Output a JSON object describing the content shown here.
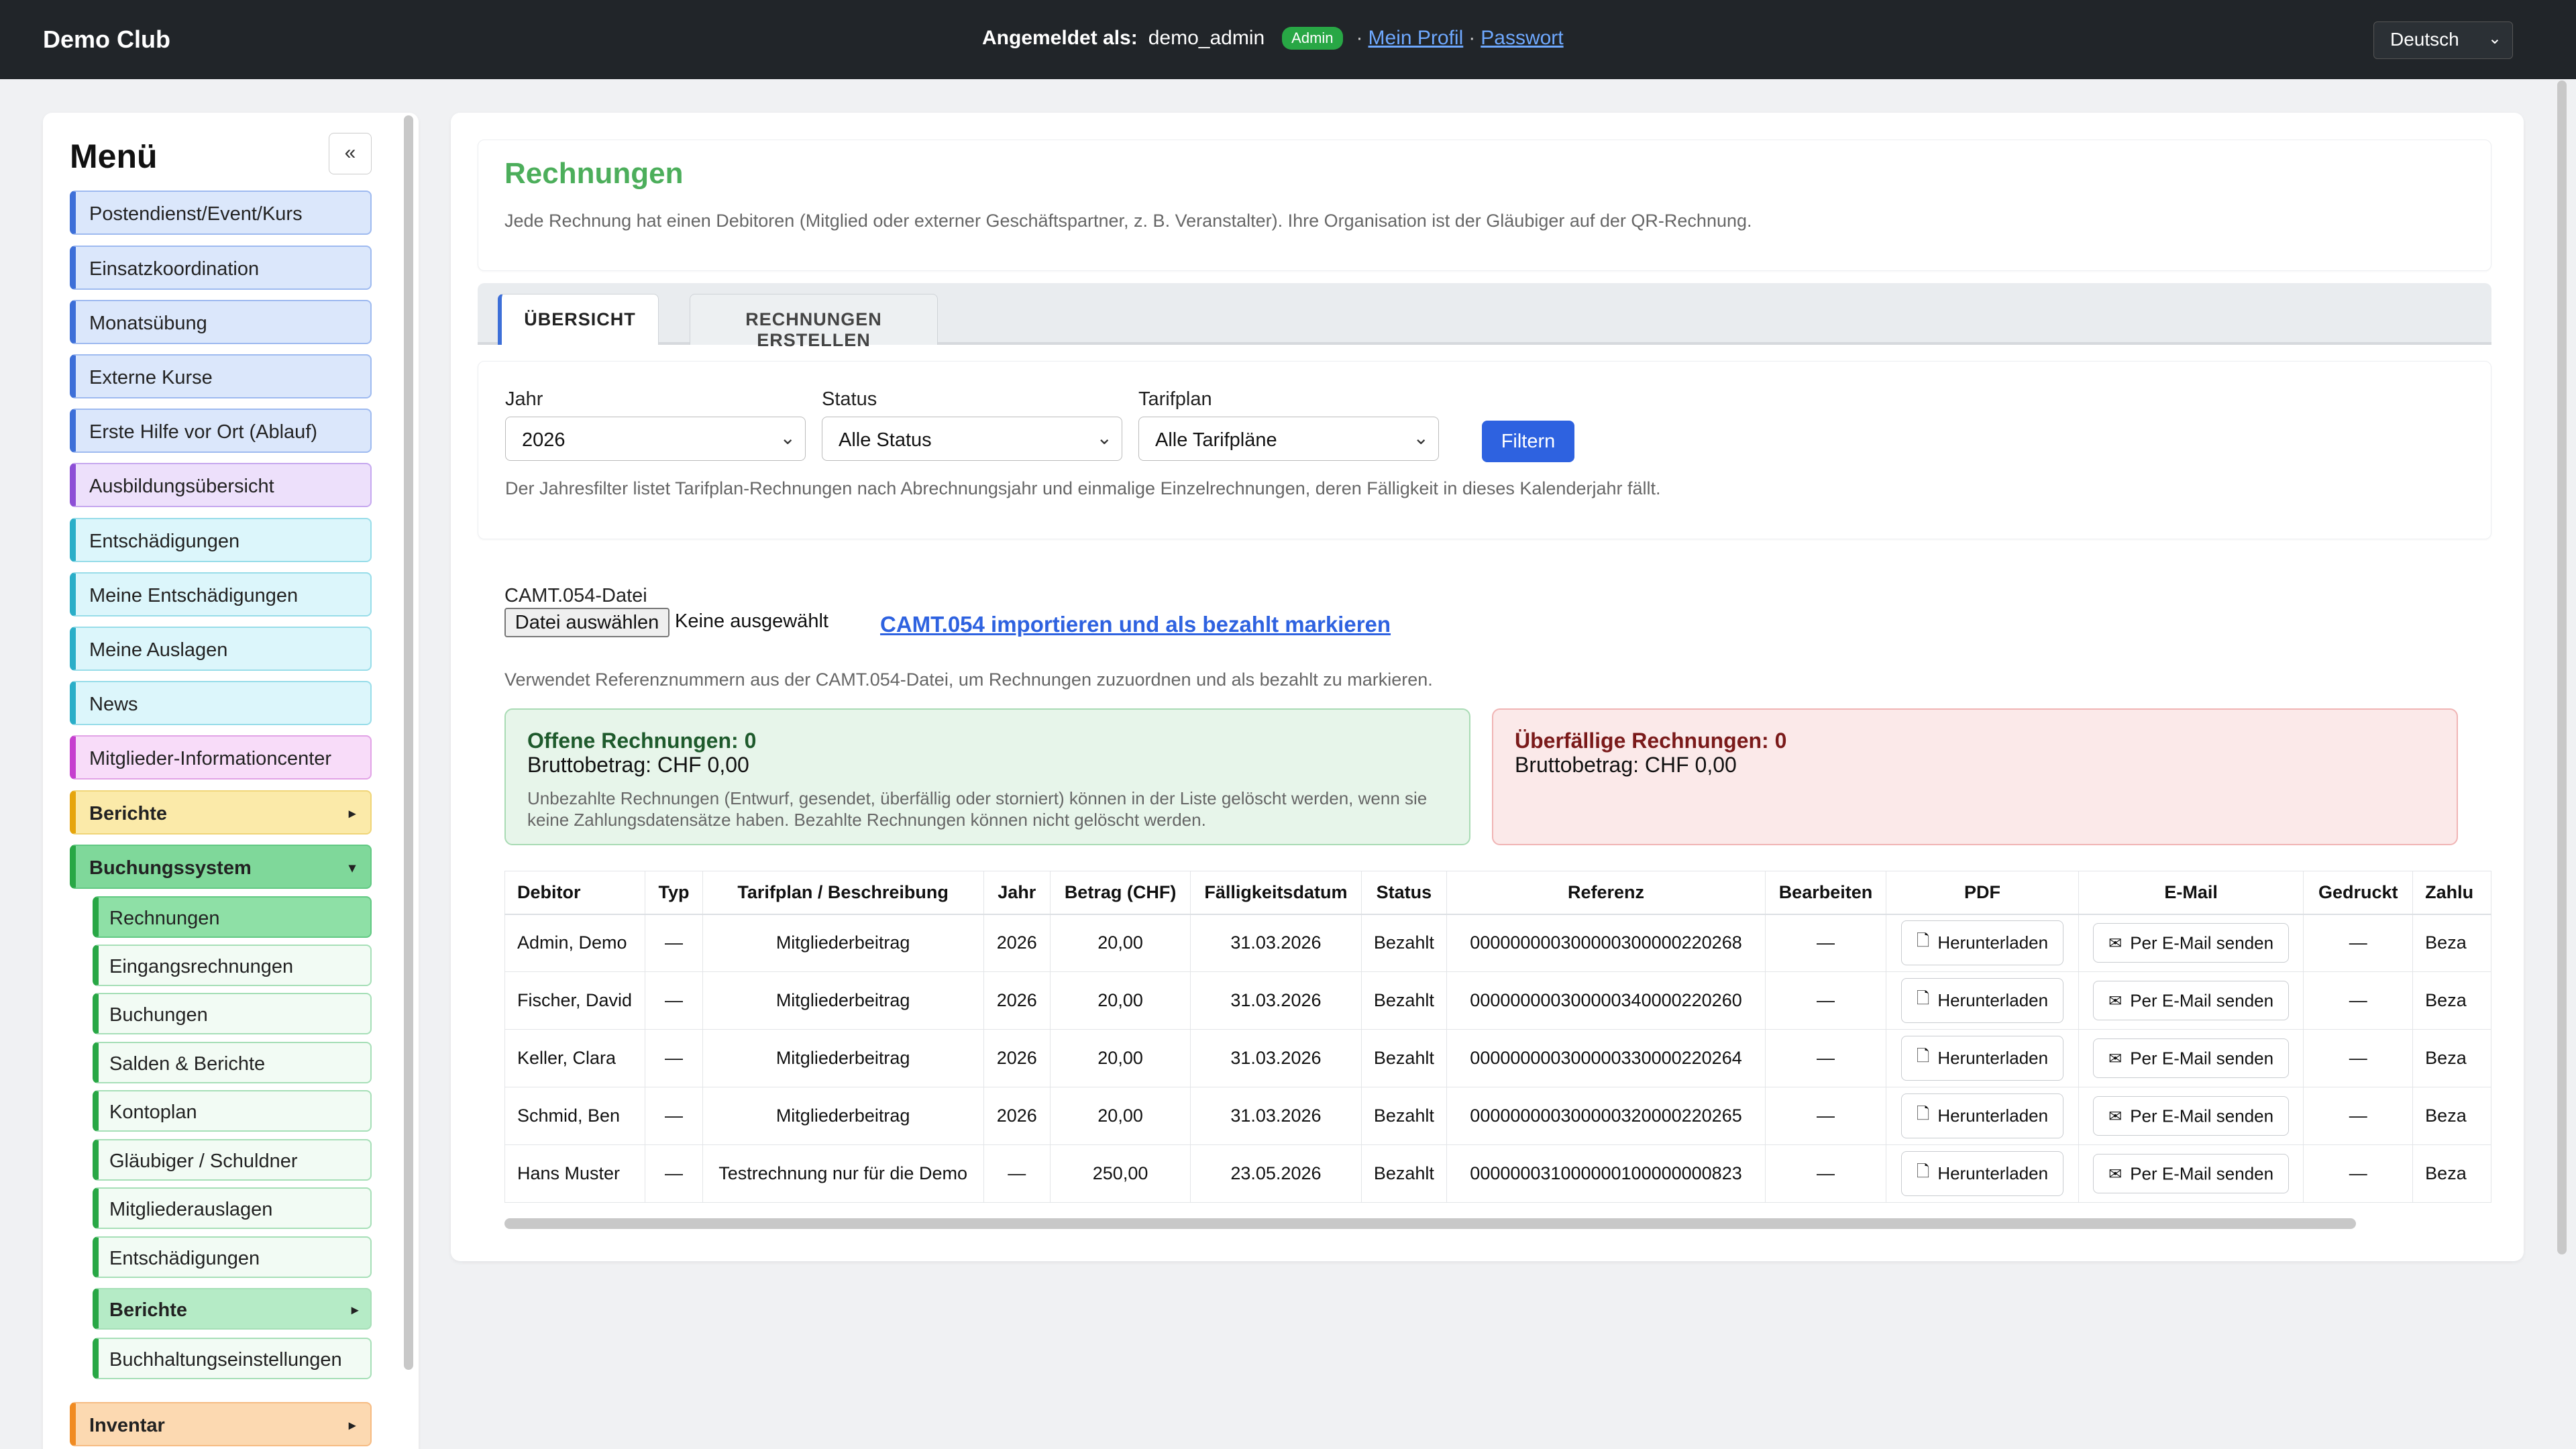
{
  "header": {
    "brand": "Demo Club",
    "logged_in_label": "Angemeldet als:",
    "username": "demo_admin",
    "role_badge": "Admin",
    "profile_link": "Mein Profil",
    "separator": "·",
    "password_link": "Passwort",
    "language": "Deutsch"
  },
  "sidebar": {
    "title": "Menü",
    "collapse_label": "«",
    "items": [
      {
        "label": "Postendienst/Event/Kurs"
      },
      {
        "label": "Einsatzkoordination"
      },
      {
        "label": "Monatsübung"
      },
      {
        "label": "Externe Kurse"
      },
      {
        "label": "Erste Hilfe vor Ort (Ablauf)"
      },
      {
        "label": "Ausbildungsübersicht"
      },
      {
        "label": "Entschädigungen"
      },
      {
        "label": "Meine Entschädigungen"
      },
      {
        "label": "Meine Auslagen"
      },
      {
        "label": "News"
      },
      {
        "label": "Mitglieder-Informationcenter"
      },
      {
        "label": "Berichte"
      },
      {
        "label": "Buchungssystem"
      },
      {
        "label": "Inventar"
      }
    ],
    "submenu": [
      {
        "label": "Rechnungen"
      },
      {
        "label": "Eingangsrechnungen"
      },
      {
        "label": "Buchungen"
      },
      {
        "label": "Salden & Berichte"
      },
      {
        "label": "Kontoplan"
      },
      {
        "label": "Gläubiger / Schuldner"
      },
      {
        "label": "Mitgliederauslagen"
      },
      {
        "label": "Entschädigungen"
      },
      {
        "label": "Berichte"
      },
      {
        "label": "Buchhaltungseinstellungen"
      }
    ]
  },
  "page": {
    "title": "Rechnungen",
    "description": "Jede Rechnung hat einen Debitoren (Mitglied oder externer Geschäftspartner, z. B. Veranstalter). Ihre Organisation ist der Gläubiger auf der QR-Rechnung."
  },
  "tabs": [
    {
      "label": "ÜBERSICHT"
    },
    {
      "label": "RECHNUNGEN ERSTELLEN"
    }
  ],
  "filters": {
    "year_label": "Jahr",
    "year_value": "2026",
    "status_label": "Status",
    "status_value": "Alle Status",
    "plan_label": "Tarifplan",
    "plan_value": "Alle Tarifpläne",
    "button": "Filtern",
    "note": "Der Jahresfilter listet Tarifplan-Rechnungen nach Abrechnungsjahr und einmalige Einzelrechnungen, deren Fälligkeit in dieses Kalenderjahr fällt."
  },
  "camt": {
    "label": "CAMT.054-Datei",
    "file_button": "Datei auswählen",
    "file_none": "Keine ausgewählt",
    "import_link": "CAMT.054 importieren und als bezahlt markieren",
    "note": "Verwendet Referenznummern aus der CAMT.054-Datei, um Rechnungen zuzuordnen und als bezahlt zu markieren."
  },
  "summary": {
    "open_title": "Offene Rechnungen: 0",
    "open_amount": "Bruttobetrag: CHF 0,00",
    "open_note": "Unbezahlte Rechnungen (Entwurf, gesendet, überfällig oder storniert) können in der Liste gelöscht werden, wenn sie keine Zahlungsdatensätze haben. Bezahlte Rechnungen können nicht gelöscht werden.",
    "overdue_title": "Überfällige Rechnungen: 0",
    "overdue_amount": "Bruttobetrag: CHF 0,00"
  },
  "table": {
    "columns": [
      "Debitor",
      "Typ",
      "Tarifplan / Beschreibung",
      "Jahr",
      "Betrag (CHF)",
      "Fälligkeitsdatum",
      "Status",
      "Referenz",
      "Bearbeiten",
      "PDF",
      "E-Mail",
      "Gedruckt",
      "Zahlu"
    ],
    "download_label": "Herunterladen",
    "email_label": "Per E-Mail senden",
    "rows": [
      {
        "debitor": "Admin, Demo",
        "typ": "—",
        "plan": "Mitgliederbeitrag",
        "jahr": "2026",
        "betrag": "20,00",
        "faellig": "31.03.2026",
        "status": "Bezahlt",
        "referenz": "000000000300000300000220268",
        "edit": "—",
        "printed": "—",
        "pay": "Beza"
      },
      {
        "debitor": "Fischer, David",
        "typ": "—",
        "plan": "Mitgliederbeitrag",
        "jahr": "2026",
        "betrag": "20,00",
        "faellig": "31.03.2026",
        "status": "Bezahlt",
        "referenz": "000000000300000340000220260",
        "edit": "—",
        "printed": "—",
        "pay": "Beza"
      },
      {
        "debitor": "Keller, Clara",
        "typ": "—",
        "plan": "Mitgliederbeitrag",
        "jahr": "2026",
        "betrag": "20,00",
        "faellig": "31.03.2026",
        "status": "Bezahlt",
        "referenz": "000000000300000330000220264",
        "edit": "—",
        "printed": "—",
        "pay": "Beza"
      },
      {
        "debitor": "Schmid, Ben",
        "typ": "—",
        "plan": "Mitgliederbeitrag",
        "jahr": "2026",
        "betrag": "20,00",
        "faellig": "31.03.2026",
        "status": "Bezahlt",
        "referenz": "000000000300000320000220265",
        "edit": "—",
        "printed": "—",
        "pay": "Beza"
      },
      {
        "debitor": "Hans Muster",
        "typ": "—",
        "plan": "Testrechnung nur für die Demo",
        "jahr": "—",
        "betrag": "250,00",
        "faellig": "23.05.2026",
        "status": "Bezahlt",
        "referenz": "000000031000000100000000823",
        "edit": "—",
        "printed": "—",
        "pay": "Beza"
      }
    ]
  }
}
